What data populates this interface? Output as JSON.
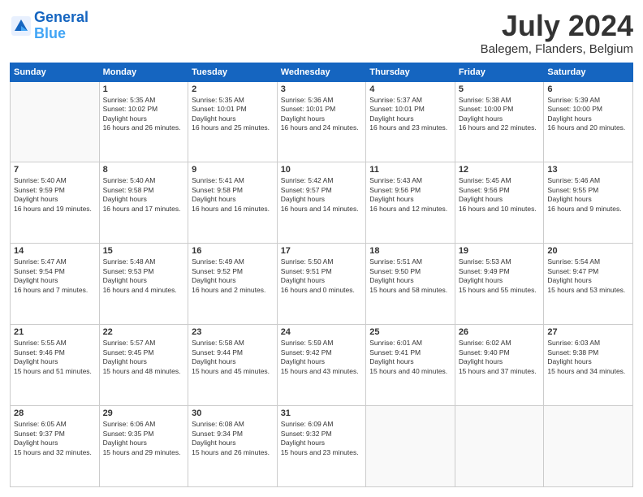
{
  "header": {
    "logo_line1": "General",
    "logo_line2": "Blue",
    "month": "July 2024",
    "location": "Balegem, Flanders, Belgium"
  },
  "days_of_week": [
    "Sunday",
    "Monday",
    "Tuesday",
    "Wednesday",
    "Thursday",
    "Friday",
    "Saturday"
  ],
  "weeks": [
    [
      {
        "day": "",
        "sunrise": "",
        "sunset": "",
        "daylight": ""
      },
      {
        "day": "1",
        "sunrise": "5:35 AM",
        "sunset": "10:02 PM",
        "daylight": "16 hours and 26 minutes."
      },
      {
        "day": "2",
        "sunrise": "5:35 AM",
        "sunset": "10:01 PM",
        "daylight": "16 hours and 25 minutes."
      },
      {
        "day": "3",
        "sunrise": "5:36 AM",
        "sunset": "10:01 PM",
        "daylight": "16 hours and 24 minutes."
      },
      {
        "day": "4",
        "sunrise": "5:37 AM",
        "sunset": "10:01 PM",
        "daylight": "16 hours and 23 minutes."
      },
      {
        "day": "5",
        "sunrise": "5:38 AM",
        "sunset": "10:00 PM",
        "daylight": "16 hours and 22 minutes."
      },
      {
        "day": "6",
        "sunrise": "5:39 AM",
        "sunset": "10:00 PM",
        "daylight": "16 hours and 20 minutes."
      }
    ],
    [
      {
        "day": "7",
        "sunrise": "5:40 AM",
        "sunset": "9:59 PM",
        "daylight": "16 hours and 19 minutes."
      },
      {
        "day": "8",
        "sunrise": "5:40 AM",
        "sunset": "9:58 PM",
        "daylight": "16 hours and 17 minutes."
      },
      {
        "day": "9",
        "sunrise": "5:41 AM",
        "sunset": "9:58 PM",
        "daylight": "16 hours and 16 minutes."
      },
      {
        "day": "10",
        "sunrise": "5:42 AM",
        "sunset": "9:57 PM",
        "daylight": "16 hours and 14 minutes."
      },
      {
        "day": "11",
        "sunrise": "5:43 AM",
        "sunset": "9:56 PM",
        "daylight": "16 hours and 12 minutes."
      },
      {
        "day": "12",
        "sunrise": "5:45 AM",
        "sunset": "9:56 PM",
        "daylight": "16 hours and 10 minutes."
      },
      {
        "day": "13",
        "sunrise": "5:46 AM",
        "sunset": "9:55 PM",
        "daylight": "16 hours and 9 minutes."
      }
    ],
    [
      {
        "day": "14",
        "sunrise": "5:47 AM",
        "sunset": "9:54 PM",
        "daylight": "16 hours and 7 minutes."
      },
      {
        "day": "15",
        "sunrise": "5:48 AM",
        "sunset": "9:53 PM",
        "daylight": "16 hours and 4 minutes."
      },
      {
        "day": "16",
        "sunrise": "5:49 AM",
        "sunset": "9:52 PM",
        "daylight": "16 hours and 2 minutes."
      },
      {
        "day": "17",
        "sunrise": "5:50 AM",
        "sunset": "9:51 PM",
        "daylight": "16 hours and 0 minutes."
      },
      {
        "day": "18",
        "sunrise": "5:51 AM",
        "sunset": "9:50 PM",
        "daylight": "15 hours and 58 minutes."
      },
      {
        "day": "19",
        "sunrise": "5:53 AM",
        "sunset": "9:49 PM",
        "daylight": "15 hours and 55 minutes."
      },
      {
        "day": "20",
        "sunrise": "5:54 AM",
        "sunset": "9:47 PM",
        "daylight": "15 hours and 53 minutes."
      }
    ],
    [
      {
        "day": "21",
        "sunrise": "5:55 AM",
        "sunset": "9:46 PM",
        "daylight": "15 hours and 51 minutes."
      },
      {
        "day": "22",
        "sunrise": "5:57 AM",
        "sunset": "9:45 PM",
        "daylight": "15 hours and 48 minutes."
      },
      {
        "day": "23",
        "sunrise": "5:58 AM",
        "sunset": "9:44 PM",
        "daylight": "15 hours and 45 minutes."
      },
      {
        "day": "24",
        "sunrise": "5:59 AM",
        "sunset": "9:42 PM",
        "daylight": "15 hours and 43 minutes."
      },
      {
        "day": "25",
        "sunrise": "6:01 AM",
        "sunset": "9:41 PM",
        "daylight": "15 hours and 40 minutes."
      },
      {
        "day": "26",
        "sunrise": "6:02 AM",
        "sunset": "9:40 PM",
        "daylight": "15 hours and 37 minutes."
      },
      {
        "day": "27",
        "sunrise": "6:03 AM",
        "sunset": "9:38 PM",
        "daylight": "15 hours and 34 minutes."
      }
    ],
    [
      {
        "day": "28",
        "sunrise": "6:05 AM",
        "sunset": "9:37 PM",
        "daylight": "15 hours and 32 minutes."
      },
      {
        "day": "29",
        "sunrise": "6:06 AM",
        "sunset": "9:35 PM",
        "daylight": "15 hours and 29 minutes."
      },
      {
        "day": "30",
        "sunrise": "6:08 AM",
        "sunset": "9:34 PM",
        "daylight": "15 hours and 26 minutes."
      },
      {
        "day": "31",
        "sunrise": "6:09 AM",
        "sunset": "9:32 PM",
        "daylight": "15 hours and 23 minutes."
      },
      {
        "day": "",
        "sunrise": "",
        "sunset": "",
        "daylight": ""
      },
      {
        "day": "",
        "sunrise": "",
        "sunset": "",
        "daylight": ""
      },
      {
        "day": "",
        "sunrise": "",
        "sunset": "",
        "daylight": ""
      }
    ]
  ]
}
